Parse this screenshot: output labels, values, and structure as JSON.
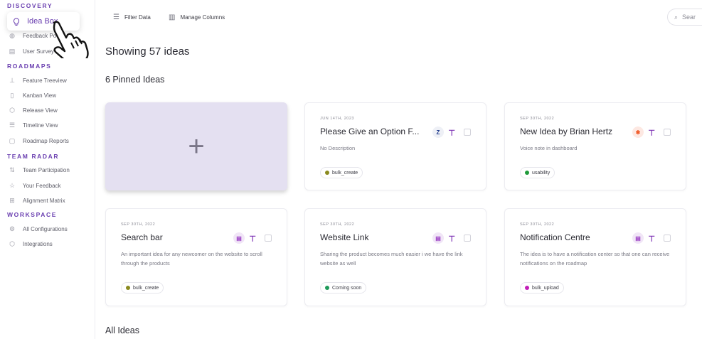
{
  "sidebar": {
    "sections": [
      {
        "title": "DISCOVERY"
      },
      {
        "title": "ROADMAPS"
      },
      {
        "title": "TEAM RADAR"
      },
      {
        "title": "WORKSPACE"
      }
    ],
    "items": [
      {
        "label": "Idea Box",
        "icon": "bulb-icon",
        "active": true
      },
      {
        "label": "Feedback Po",
        "icon": "globe-icon"
      },
      {
        "label": "User Survey",
        "icon": "clipboard-icon"
      },
      {
        "label": "Feature Treeview",
        "icon": "tree-icon"
      },
      {
        "label": "Kanban View",
        "icon": "kanban-icon"
      },
      {
        "label": "Release View",
        "icon": "box-icon"
      },
      {
        "label": "Timeline View",
        "icon": "timeline-icon"
      },
      {
        "label": "Roadmap Reports",
        "icon": "report-icon"
      },
      {
        "label": "Team Participation",
        "icon": "participation-icon"
      },
      {
        "label": "Your Feedback",
        "icon": "star-icon"
      },
      {
        "label": "Alignment Matrix",
        "icon": "matrix-icon"
      },
      {
        "label": "All Configurations",
        "icon": "settings-icon"
      },
      {
        "label": "Integrations",
        "icon": "integrations-icon"
      }
    ]
  },
  "toolbar": {
    "filter_label": "Filter Data",
    "columns_label": "Manage Columns",
    "search_placeholder": "Sear"
  },
  "main": {
    "heading": "Showing 57 ideas",
    "pinned_heading": "6 Pinned Ideas",
    "all_heading": "All Ideas"
  },
  "cards": [
    {
      "date": "JUN 14TH, 2023",
      "title": "Please Give an Option F...",
      "desc": "No Description",
      "tag": "bulk_create",
      "tag_color": "#8a8a1f",
      "badge": "Z",
      "badge_bg": "#eef0f6",
      "badge_color": "#1e3a8a"
    },
    {
      "date": "SEP 30TH, 2022",
      "title": "New Idea by Brian Hertz",
      "desc": "Voice note in dashboard",
      "tag": "usability",
      "tag_color": "#1f9a3a",
      "badge": "✱",
      "badge_bg": "#fde8e2",
      "badge_color": "#f05a28"
    },
    {
      "date": "SEP 30TH, 2022",
      "title": "Search bar",
      "desc": "An important idea for any newcomer on the website to scroll through the products",
      "tag": "bulk_create",
      "tag_color": "#8a8a1f",
      "badge": "▤",
      "badge_bg": "#f1e6f7",
      "badge_color": "#9b3fc4"
    },
    {
      "date": "SEP 30TH, 2022",
      "title": "Website Link",
      "desc": "Sharing the product becomes much easier i we have the link website as well",
      "tag": "Coming soon",
      "tag_color": "#1f9a5a",
      "badge": "▤",
      "badge_bg": "#f1e6f7",
      "badge_color": "#9b3fc4"
    },
    {
      "date": "SEP 30TH, 2022",
      "title": "Notification Centre",
      "desc": "The idea is to have a notification center so that one can receive notifications on the roadmap",
      "tag": "bulk_upload",
      "tag_color": "#c21fb8",
      "badge": "▤",
      "badge_bg": "#f1e6f7",
      "badge_color": "#9b3fc4"
    }
  ],
  "add_card": {
    "symbol": "+"
  },
  "colors": {
    "accent": "#6a3fb0",
    "pin": "#7b2fb3",
    "add_card_bg": "#e4e0f1"
  }
}
